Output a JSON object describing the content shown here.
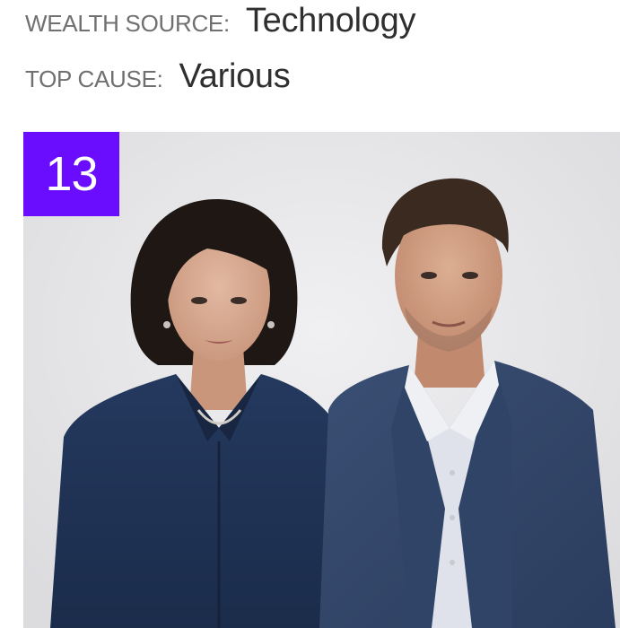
{
  "wealth_source": {
    "label": "WEALTH SOURCE:",
    "value": "Technology"
  },
  "top_cause": {
    "label": "TOP CAUSE:",
    "value": "Various"
  },
  "rank": {
    "value": "13"
  },
  "photo": {
    "icon": "portrait-photo-icon"
  },
  "colors": {
    "badge": "#6a0dff",
    "label": "#707070",
    "value": "#2f2f2f"
  }
}
